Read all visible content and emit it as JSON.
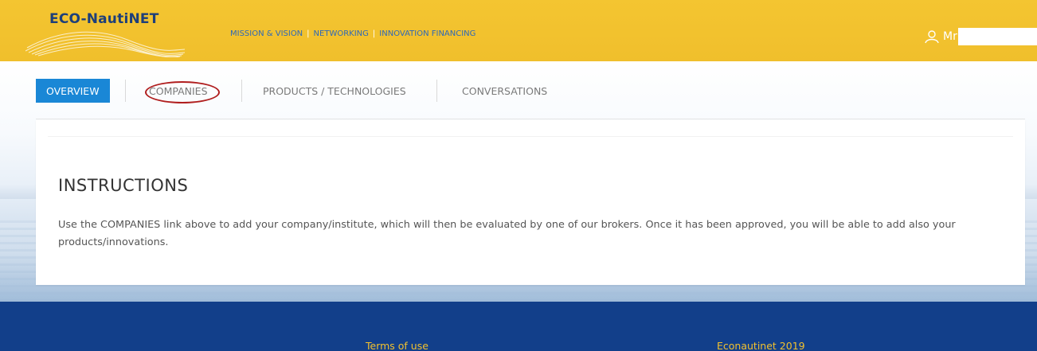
{
  "header": {
    "logo_text": "ECO-NautiNET",
    "nav": [
      {
        "label": "MISSION & VISION"
      },
      {
        "label": "NETWORKING"
      },
      {
        "label": "INNOVATION FINANCING"
      }
    ],
    "nav_separator": "|",
    "user_name": "Mr"
  },
  "tabs": {
    "overview": "OVERVIEW",
    "companies": "COMPANIES",
    "products": "PRODUCTS / TECHNOLOGIES",
    "conversations": "CONVERSATIONS"
  },
  "instructions": {
    "title": "INSTRUCTIONS",
    "body": "Use the COMPANIES link above to add your company/institute, which will then be evaluated by one of our brokers. Once it has been approved, you will be able to add also your products/innovations."
  },
  "footer": {
    "terms": "Terms of use",
    "copyright": "Econautinet 2019"
  },
  "colors": {
    "header_bg": "#f2c12e",
    "tab_active": "#1a87d6",
    "footer_bg": "#123f8a",
    "footer_link": "#f2c12e",
    "annotation_circle": "#b01e1e"
  },
  "icons": {
    "user": "user-icon"
  }
}
